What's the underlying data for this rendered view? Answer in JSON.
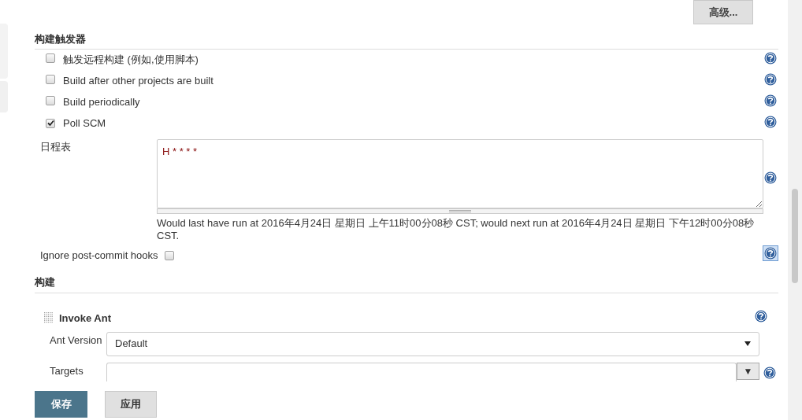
{
  "advanced_button": "高级...",
  "triggers": {
    "title": "构建触发器",
    "options": [
      {
        "label": "触发远程构建 (例如,使用脚本)",
        "checked": false
      },
      {
        "label": "Build after other projects are built",
        "checked": false
      },
      {
        "label": "Build periodically",
        "checked": false
      },
      {
        "label": "Poll SCM",
        "checked": true
      }
    ],
    "schedule": {
      "label": "日程表",
      "value": "H * * * *",
      "note": "Would last have run at 2016年4月24日 星期日 上午11时00分08秒 CST; would next run at 2016年4月24日 星期日 下午12时00分08秒 CST."
    },
    "ignore_hooks": {
      "label": "Ignore post-commit hooks",
      "checked": false
    }
  },
  "build": {
    "title": "构建",
    "step": {
      "title": "Invoke Ant",
      "ant_version": {
        "label": "Ant Version",
        "value": "Default"
      },
      "targets": {
        "label": "Targets",
        "dropdown_button": "▼"
      }
    }
  },
  "buttons": [
    {
      "label": "保存",
      "kind": "primary"
    },
    {
      "label": "应用",
      "kind": "secondary"
    }
  ]
}
